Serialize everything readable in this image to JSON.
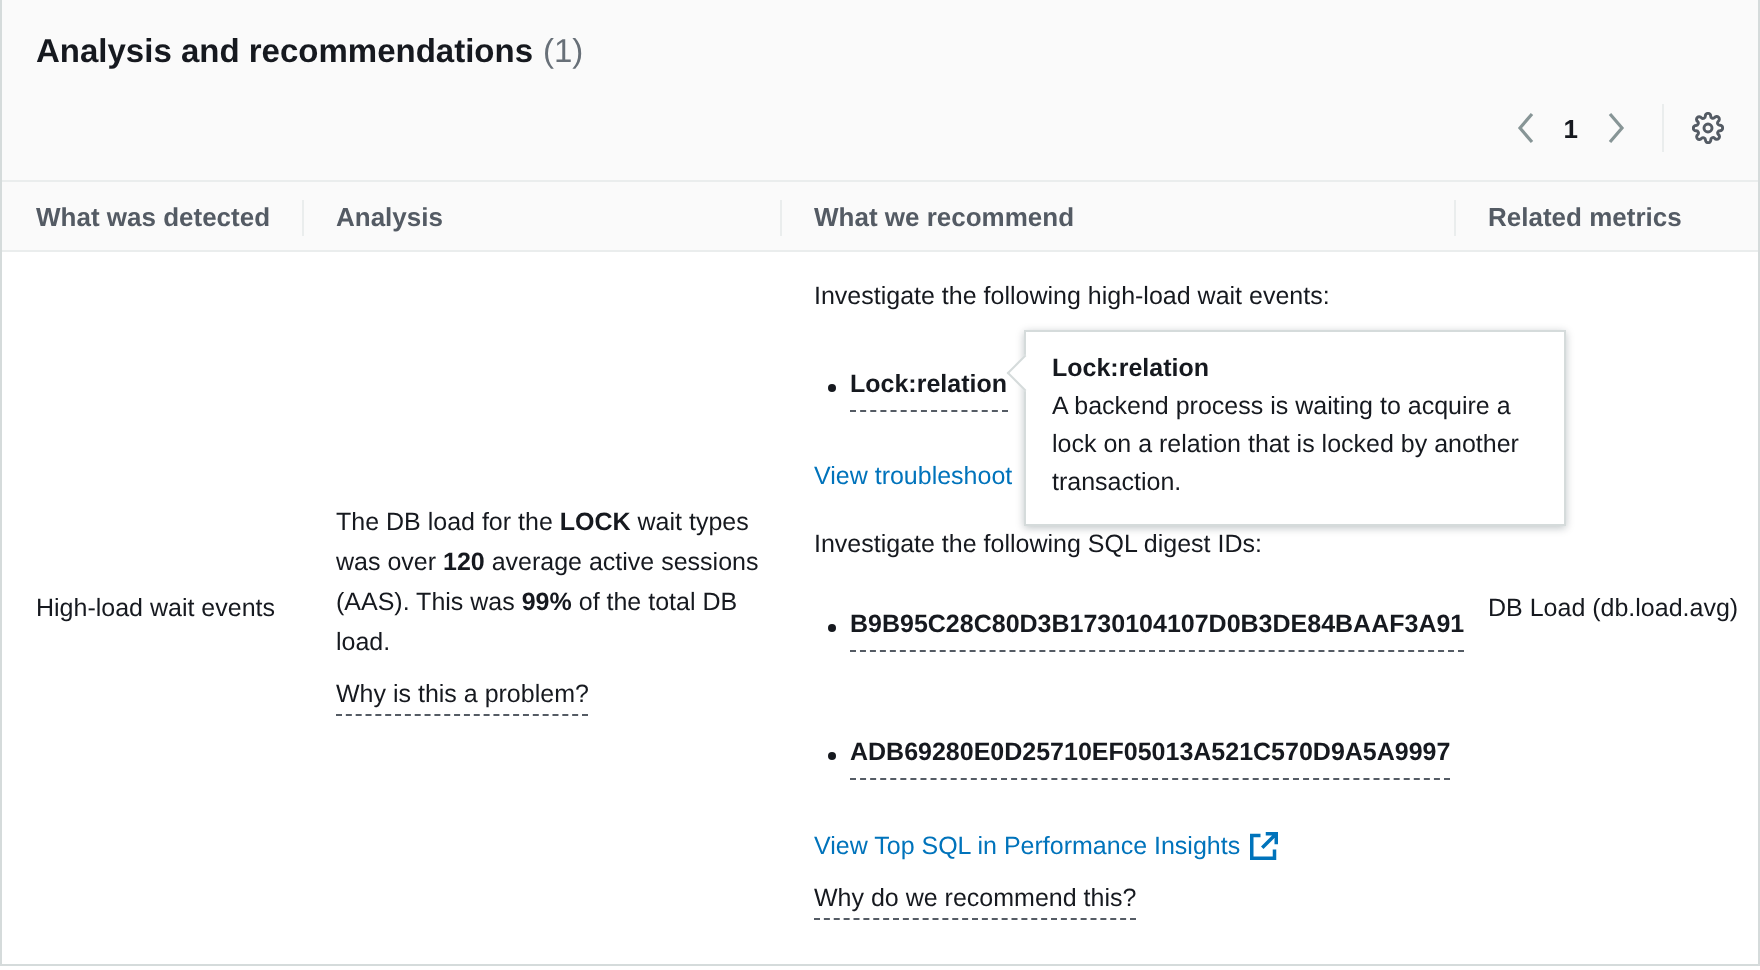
{
  "header": {
    "title": "Analysis and recommendations",
    "count": "(1)"
  },
  "pagination": {
    "page": "1"
  },
  "columns": [
    "What was detected",
    "Analysis",
    "What we recommend",
    "Related metrics"
  ],
  "row": {
    "detected": "High-load wait events",
    "analysis": "The DB load for the **LOCK** wait types was over **120** average active sessions (AAS). This was **99%** of the total DB load.",
    "analysis_link": "Why is this a problem?",
    "recommendations": [
      {
        "intro": "Investigate the following high-load wait events:",
        "items": [
          {
            "label": "Lock:relation",
            "tooltip": {
              "title": "Lock:relation",
              "text": "A backend process is waiting to acquire a lock on a relation that is locked by another transaction."
            }
          }
        ],
        "link": {
          "text": "View troubleshoot",
          "external": false
        }
      },
      {
        "intro": "Investigate the following SQL digest IDs:",
        "items": [
          {
            "label": "B9B95C28C80D3B1730104107D0B3DE84BAAF3A91"
          },
          {
            "label": "ADB69280E0D25710EF05013A521C570D9A5A9997"
          }
        ],
        "link": {
          "text": "View Top SQL in Performance Insights",
          "external": true
        }
      }
    ],
    "recommend_link": "Why do we recommend this?",
    "metric": "DB Load (db.load.avg)"
  }
}
